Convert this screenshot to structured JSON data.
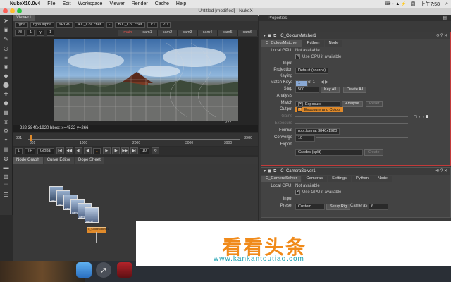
{
  "menubar": {
    "app": "NukeX10.0v4",
    "items": [
      "File",
      "Edit",
      "Workspace",
      "Viewer",
      "Render",
      "Cache",
      "Help"
    ],
    "clock": "周一上午7:58"
  },
  "window": {
    "title": "Untitled [modified] - NukeX"
  },
  "viewer": {
    "tab": "Viewer1",
    "channels": "rgba",
    "alpha": "rgba.alpha",
    "colorspace": "sRGB",
    "input_a": "C_Col..cher",
    "input_b": "C_Col..cher",
    "zoom": "1:1",
    "mode": "2D",
    "cam_tabs": [
      "main",
      "cam1",
      "cam2",
      "cam3",
      "cam4",
      "cam5",
      "cam6"
    ],
    "f_stop": "f/8",
    "f_stop_extra": "1",
    "gain_value": "0",
    "gamma_value": "1",
    "status": "222 3840x1920  bbox: x=4522 y=266",
    "corner_value": "222"
  },
  "timeline": {
    "start": "301",
    "marks": [
      "301",
      "1000",
      "2000",
      "3000",
      "3900"
    ],
    "end": "3900",
    "fps": "TF",
    "global": "Global",
    "frame": "1",
    "step": "10",
    "counter": "1"
  },
  "nodegraph": {
    "tabs": [
      "Node Graph",
      "Curve Editor",
      "Dope Sheet"
    ],
    "nodes": [
      "cam1",
      "cam2",
      "cam3",
      "cam4",
      "cam5",
      "cam6"
    ],
    "selected_node": "C_ColourMatcher1"
  },
  "properties": {
    "header": "Properties",
    "matcher": {
      "name": "C_ColourMatcher1",
      "tabs": [
        "C_ColourMatcher",
        "Python",
        "Node"
      ],
      "local_gpu_label": "Local GPU:",
      "local_gpu_value": "Not available",
      "use_gpu": "Use GPU if available",
      "input_label": "Input",
      "projection_label": "Projection",
      "projection_value": "Default (source)",
      "keying_label": "Keying",
      "match_keys_label": "Match Keys",
      "match_keys_value": "1",
      "match_keys_of": "of 1",
      "step_label": "Step",
      "step_value": "500",
      "key_all": "Key All",
      "delete_all": "Delete All",
      "analysis_label": "Analysis",
      "match_label": "Match",
      "match_option": "Exposure",
      "match_dropdown_selected": "Exposure and Colour",
      "analyse": "Analyse",
      "reset": "Reset",
      "output_label": "Output",
      "gains_label": "Gains",
      "exposure_label": "Exposure",
      "format_label": "Format",
      "format_value": "root.format 3840x1920",
      "converge_label": "Converge",
      "converge_value": "10",
      "export_label": "Export",
      "export_value": "Grades (split)",
      "create": "Create"
    },
    "solver": {
      "name": "C_CameraSolver1",
      "tabs": [
        "C_CameraSolver",
        "Cameras",
        "Settings",
        "Python",
        "Node"
      ],
      "local_gpu_label": "Local GPU:",
      "local_gpu_value": "Not available",
      "use_gpu": "Use GPU if available",
      "input_label": "Input",
      "preset_label": "Preset",
      "preset_value": "Custom",
      "setup_rig": "Setup Rig",
      "cameras_label": "Cameras",
      "cameras_value": "6"
    }
  },
  "watermark": {
    "title": "看看头条",
    "url": "www.kankantoutiao.com"
  },
  "colors": {
    "accent": "#c23a3a",
    "selected_orange": "#e08a2a",
    "watermark_orange": "#f08a1a",
    "watermark_teal": "#1aa0b0"
  }
}
